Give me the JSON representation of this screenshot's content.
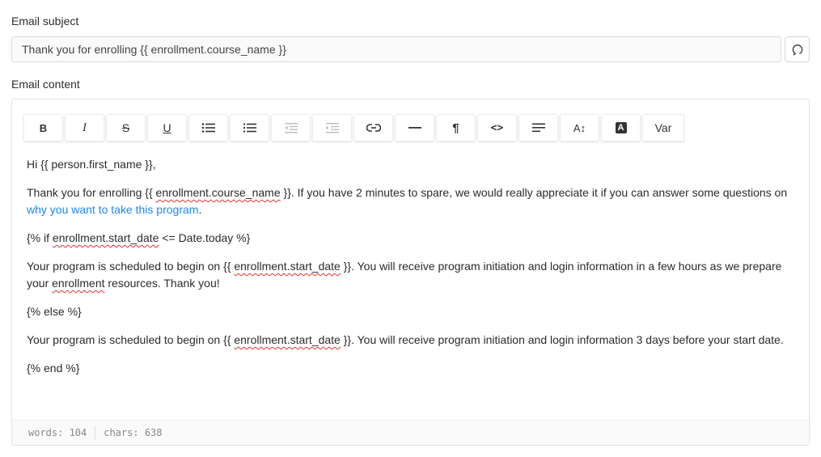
{
  "subject": {
    "label": "Email subject",
    "value": "Thank you for enrolling {{ enrollment.course_name }}",
    "refresh_icon": "refresh-icon"
  },
  "content": {
    "label": "Email content",
    "toolbar": [
      {
        "name": "bold-button",
        "text": "B",
        "icon": "bold-icon"
      },
      {
        "name": "italic-button",
        "text": "I",
        "icon": "italic-icon"
      },
      {
        "name": "strikethrough-button",
        "text": "S",
        "icon": "strikethrough-icon"
      },
      {
        "name": "underline-button",
        "text": "U",
        "icon": "underline-icon"
      },
      {
        "name": "bullet-list-button",
        "icon": "bullet-list-icon"
      },
      {
        "name": "ordered-list-button",
        "icon": "ordered-list-icon"
      },
      {
        "name": "outdent-button",
        "icon": "outdent-icon"
      },
      {
        "name": "indent-button",
        "icon": "indent-icon"
      },
      {
        "name": "link-button",
        "icon": "link-icon"
      },
      {
        "name": "horizontal-rule-button",
        "icon": "horizontal-rule-icon"
      },
      {
        "name": "paragraph-button",
        "text": "¶",
        "icon": "paragraph-icon"
      },
      {
        "name": "code-button",
        "text": "<>",
        "icon": "code-icon"
      },
      {
        "name": "align-button",
        "icon": "align-left-icon"
      },
      {
        "name": "font-size-button",
        "text": "A↕",
        "icon": "font-size-icon"
      },
      {
        "name": "text-color-button",
        "text": "A",
        "icon": "text-color-icon"
      },
      {
        "name": "variable-button",
        "text": "Var",
        "icon": "variable-icon"
      }
    ],
    "body": {
      "greeting": "Hi {{ person.first_name }},",
      "p2_a": "Thank you for enrolling {{ ",
      "p2_spell": "enrollment.course_name",
      "p2_b": " }}. If you have 2 minutes to spare, we would really appreciate it if you can answer some questions on ",
      "p2_link": "why you want to take this program",
      "p2_c": ".",
      "if_a": "{% if ",
      "if_spell": "enrollment.start_date",
      "if_b": " <= Date.today %}",
      "p4_a": "Your program is scheduled to begin on {{ ",
      "p4_spell": "enrollment.start_date",
      "p4_b": " }}. You will receive program initiation and login information in a few hours as we prepare your ",
      "p4_spell2": "enrollment",
      "p4_c": " resources. Thank you!",
      "else_tag": "{% else %}",
      "p6_a": "Your program is scheduled to begin on {{ ",
      "p6_spell": "enrollment.start_date",
      "p6_b": " }}. You will receive program initiation and login information 3 days before your start date.",
      "end_tag": "{% end %}"
    },
    "status": {
      "words": "words: 104",
      "chars": "chars: 638"
    }
  }
}
